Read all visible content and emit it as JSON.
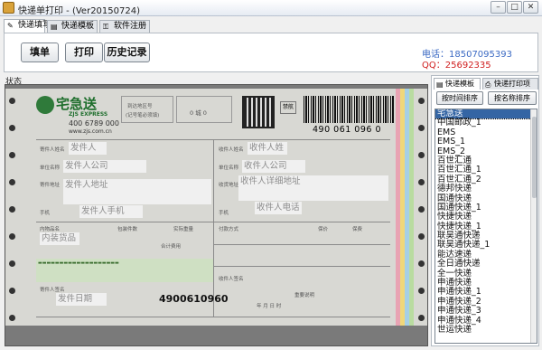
{
  "window": {
    "title": "快递单打印 - (Ver20150724)"
  },
  "maintabs": [
    {
      "label": "快递填写",
      "active": true
    },
    {
      "label": "快递模板",
      "active": false
    },
    {
      "label": "软件注册",
      "active": false
    }
  ],
  "toolbar": {
    "fill": "填单",
    "print": "打印",
    "history": "历史记录"
  },
  "contact": {
    "phone_label": "电话：",
    "phone": "18507095393",
    "qq_label": "QQ：",
    "qq": "25692335"
  },
  "status_label": "状态",
  "waybill": {
    "brand": "宅急送",
    "brand_en": "ZJS EXPRESS",
    "hotline": "400 6789 000",
    "site": "www.zjs.com.cn",
    "tracking_number": "490 061 096 0",
    "tracking_number_bottom": "4900610960",
    "box_origin": "到达地区号",
    "box_note": "(记号笔必须填)",
    "box_code": "0 城 0",
    "box_proxy": "禁航",
    "fields": {
      "sender_name": "发件人",
      "sender_company": "发件人公司",
      "sender_address": "发件人地址",
      "sender_phone": "发件人手机",
      "content": "内装货品",
      "date": "发件日期",
      "receiver_name": "收件人姓",
      "receiver_company": "收件人公司",
      "receiver_address": "收件人详细地址",
      "receiver_phone": "收件人电话"
    },
    "labels": {
      "sender_name": "寄件人姓名",
      "sender_company": "单位名称",
      "sender_address": "寄件地址",
      "sender_mobile": "手机",
      "content": "内物品名",
      "count": "包装件数",
      "weight": "实际重量",
      "receiver_name": "收件人姓名",
      "receiver_company": "单位名称",
      "receiver_address": "收货地址",
      "receiver_mobile": "手机",
      "pay": "付款方式",
      "insurance": "保价",
      "fee": "保费",
      "total": "合计费用",
      "signature": "寄件人签名",
      "receiver_sign": "收件人签名",
      "date_sign": "年 月 日 时",
      "remark": "重要说明"
    }
  },
  "right_panel": {
    "tabs": [
      {
        "label": "快递模板",
        "active": true
      },
      {
        "label": "快递打印项",
        "active": false
      }
    ],
    "sort_time": "按时间排序",
    "sort_name": "按名称排序",
    "items": [
      "宅急送",
      "中国邮政_1",
      "EMS",
      "EMS_1",
      "EMS_2",
      "百世汇通",
      "百世汇通_1",
      "百世汇通_2",
      "德邦快递",
      "国通快递",
      "国通快递_1",
      "快捷快递",
      "快捷快递_1",
      "联昊通快递",
      "联昊通快递_1",
      "能达速递",
      "全日通快递",
      "全一快递",
      "申通快递",
      "申通快递_1",
      "申通快递_2",
      "申通快递_3",
      "申通快递_4",
      "世运快递"
    ],
    "selected_index": 0
  }
}
